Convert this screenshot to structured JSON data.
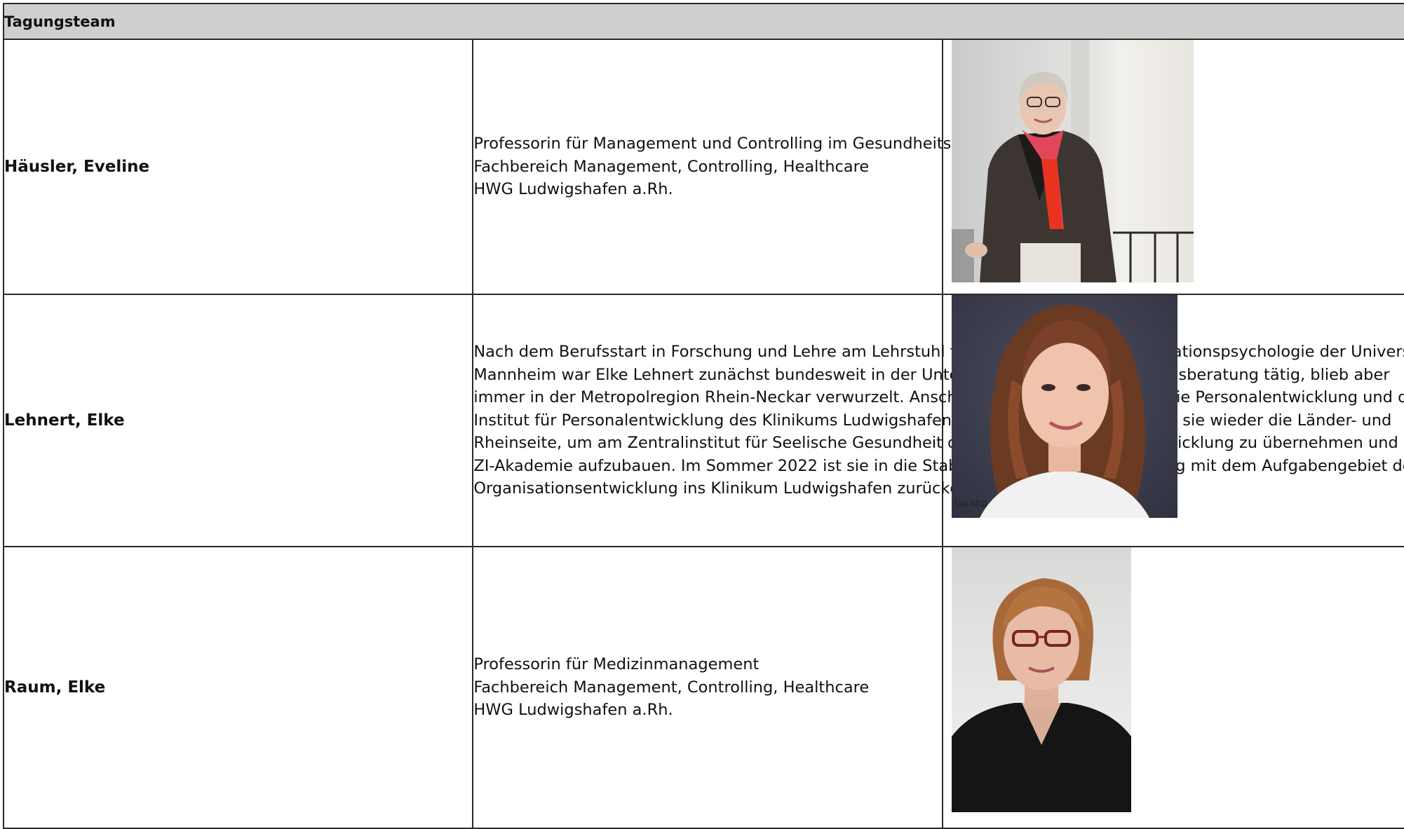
{
  "table": {
    "heading": "Tagungsteam",
    "members": [
      {
        "name": "Häusler, Eveline",
        "lines": [
          "Professorin für Management und Controlling im Gesundheitsbereich",
          "Fachbereich Management, Controlling, Healthcare",
          "HWG Ludwigshafen a.Rh."
        ],
        "photo": "portrait-photo"
      },
      {
        "name": "Lehnert, Elke",
        "lines": [
          "Nach dem Berufsstart in Forschung und Lehre am Lehrstuhl für Wirtschafts- und Organisationspsychologie der Universität",
          "Mannheim war Elke Lehnert zunächst bundesweit in der Unternehmens- und Krankenhausberatung tätig, blieb aber",
          "immer in der Metropolregion Rhein-Neckar verwurzelt. Anschließend hat sie viele Jahre die Personalentwicklung und das",
          "Institut für Personalentwicklung des Klinikums Ludwigshafen geleitet. Ab 2018 wechselte sie wieder die Länder- und",
          "Rheinseite, um am Zentralinstitut für Seelische Gesundheit die Leitung der Personalentwicklung zu übernehmen und die",
          "ZI-Akademie aufzubauen. Im Sommer 2022 ist sie in die Stabsstelle der Geschäftsführung mit dem Aufgabengebiet der",
          "Organisationsentwicklung ins Klinikum Ludwigshafen zurückgekehrt"
        ],
        "photo": "portrait-photo"
      },
      {
        "name": "Raum, Elke",
        "lines": [
          "Professorin für Medizinmanagement",
          "Fachbereich Management, Controlling, Healthcare",
          "HWG Ludwigshafen a.Rh."
        ],
        "photo": "portrait-photo"
      }
    ]
  }
}
